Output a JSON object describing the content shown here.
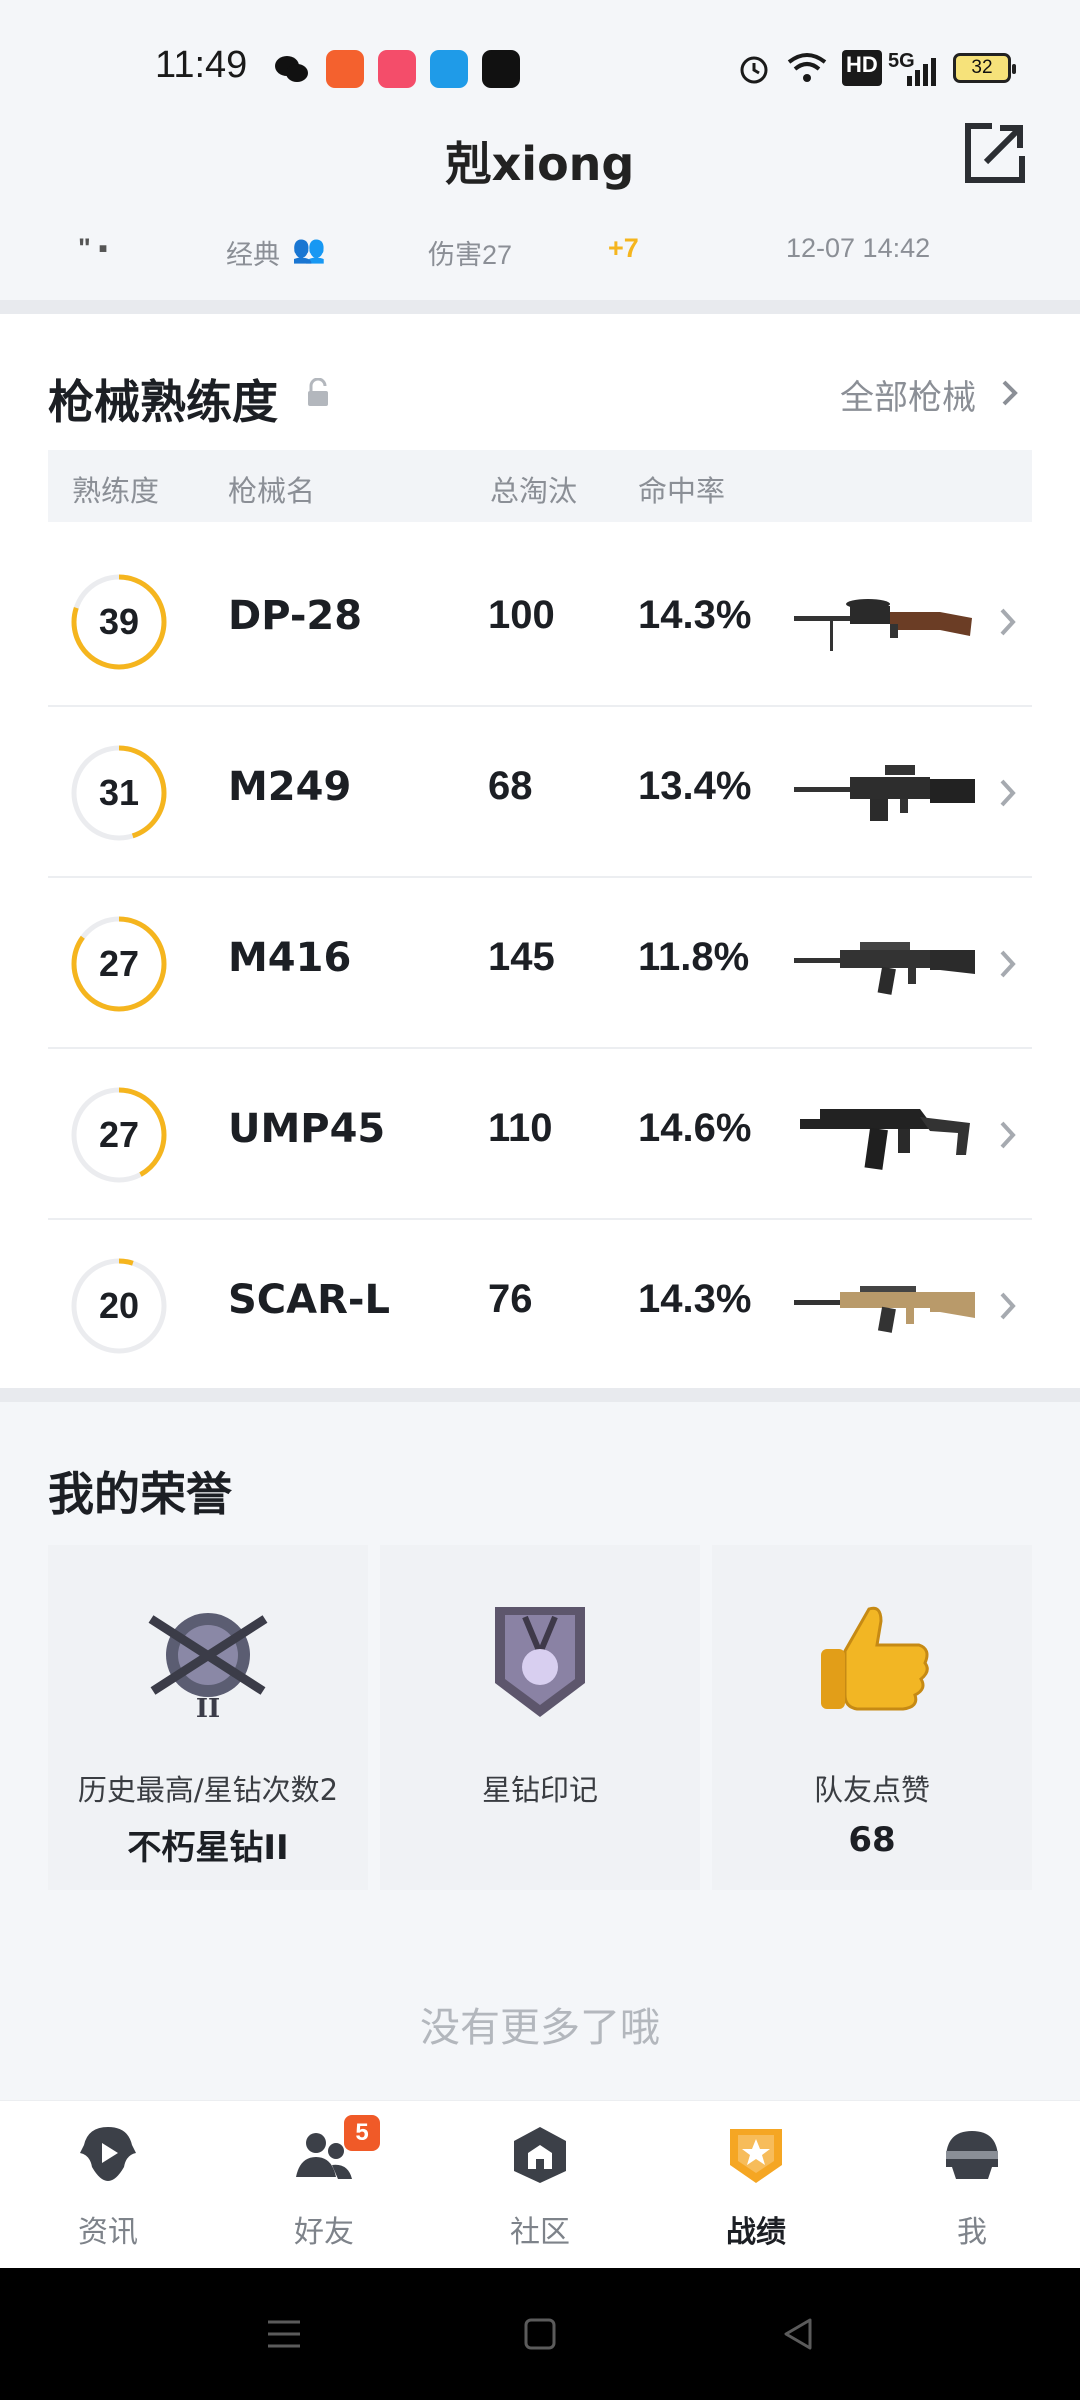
{
  "status_bar": {
    "time": "11:49",
    "network": "5G",
    "hd": "HD",
    "battery": "32"
  },
  "header": {
    "title": "剋xiong"
  },
  "match": {
    "mode": "经典",
    "damage": "伤害27",
    "delta": "+7",
    "date": "12-07 14:42"
  },
  "weapons": {
    "title": "枪械熟练度",
    "all_link": "全部枪械",
    "columns": {
      "proficiency": "熟练度",
      "name": "枪械名",
      "kills": "总淘汰",
      "accuracy": "命中率"
    },
    "rows": [
      {
        "level": "39",
        "name": "DP-28",
        "kills": "100",
        "accuracy": "14.3%",
        "progress": 0.8
      },
      {
        "level": "31",
        "name": "M249",
        "kills": "68",
        "accuracy": "13.4%",
        "progress": 0.45
      },
      {
        "level": "27",
        "name": "M416",
        "kills": "145",
        "accuracy": "11.8%",
        "progress": 0.85
      },
      {
        "level": "27",
        "name": "UMP45",
        "kills": "110",
        "accuracy": "14.6%",
        "progress": 0.42
      },
      {
        "level": "20",
        "name": "SCAR-L",
        "kills": "76",
        "accuracy": "14.3%",
        "progress": 0.05
      }
    ]
  },
  "honors": {
    "title": "我的荣誉",
    "cards": [
      {
        "label": "历史最高/星钻次数2",
        "value": "不朽星钻II",
        "icon": "rank-badge-icon"
      },
      {
        "label": "星钻印记",
        "value": "",
        "icon": "medal-icon"
      },
      {
        "label": "队友点赞",
        "value": "68",
        "icon": "thumbs-up-icon"
      }
    ]
  },
  "footer": {
    "no_more": "没有更多了哦"
  },
  "nav": {
    "items": [
      {
        "label": "资讯",
        "icon": "news-icon"
      },
      {
        "label": "好友",
        "icon": "friends-icon",
        "badge": "5"
      },
      {
        "label": "社区",
        "icon": "community-icon"
      },
      {
        "label": "战绩",
        "icon": "stats-icon",
        "active": true
      },
      {
        "label": "我",
        "icon": "profile-icon"
      }
    ]
  },
  "colors": {
    "accent": "#f5b51e",
    "ring_track": "#ebecef",
    "badge": "#f05a28"
  }
}
